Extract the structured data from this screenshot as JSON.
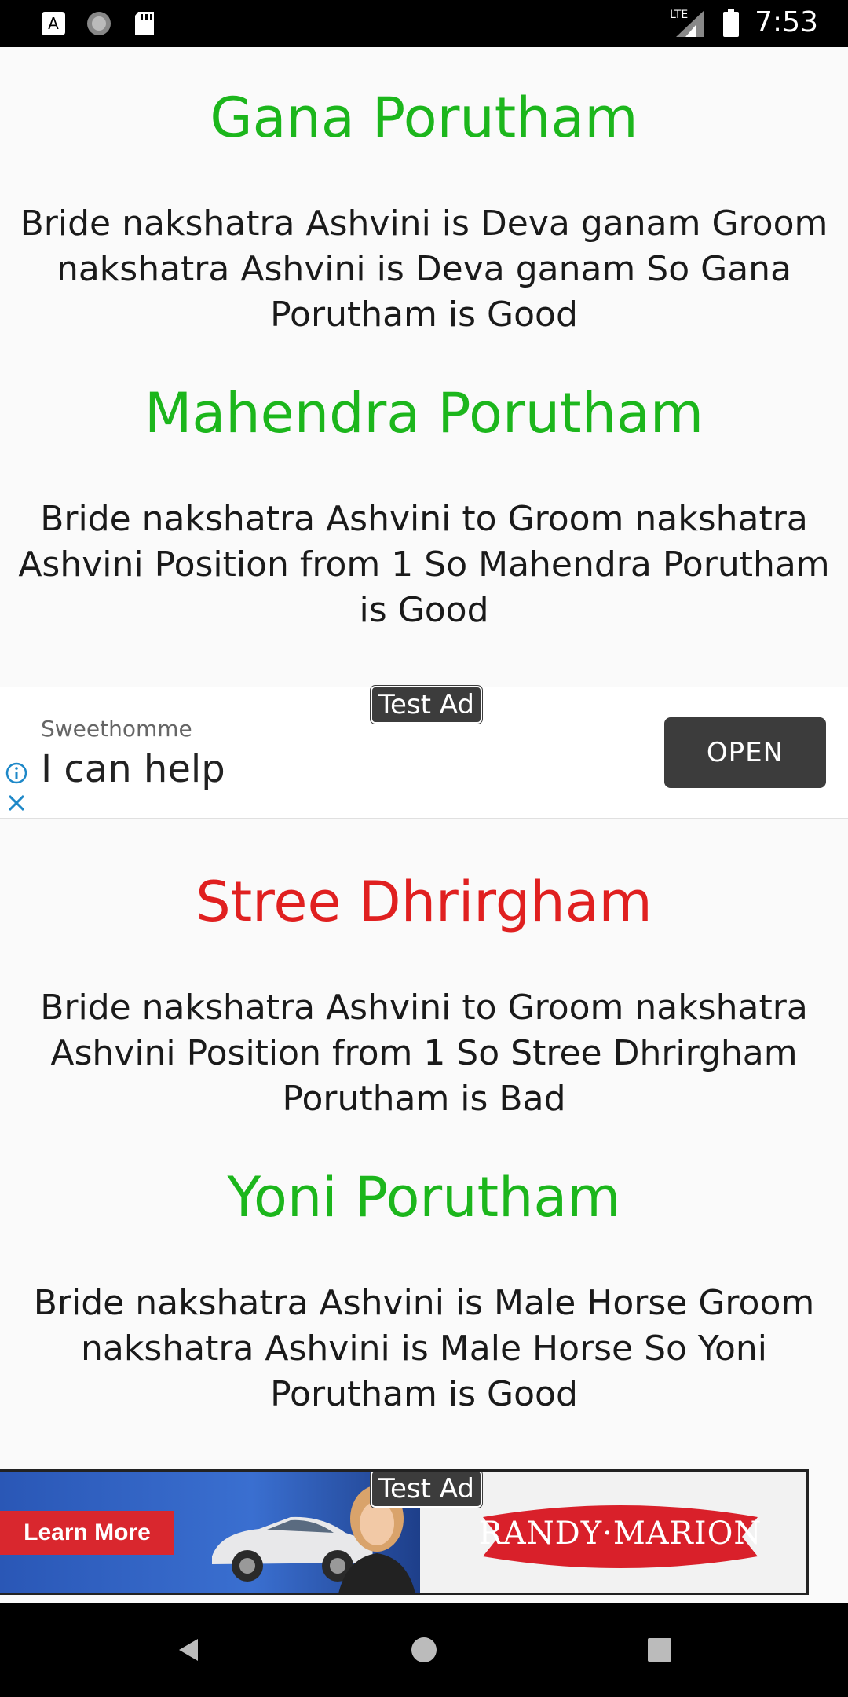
{
  "status_bar": {
    "time": "7:53",
    "network": "LTE",
    "icons": [
      "text-icon",
      "sync-icon",
      "sd-card-icon",
      "signal-icon",
      "battery-icon"
    ]
  },
  "sections": [
    {
      "title": "Gana Porutham",
      "color": "#1cb61c",
      "description": "Bride nakshatra Ashvini is Deva ganam Groom nakshatra Ashvini is Deva ganam So Gana Porutham is  Good"
    },
    {
      "title": "Mahendra Porutham",
      "color": "#1cb61c",
      "description": "Bride nakshatra Ashvini to Groom nakshatra Ashvini Position from 1 So Mahendra Porutham is Good"
    },
    {
      "title": "Stree Dhrirgham",
      "color": "#e02020",
      "description": "Bride nakshatra Ashvini to Groom nakshatra Ashvini Position from 1 So Stree Dhrirgham Porutham is Bad"
    },
    {
      "title": "Yoni Porutham",
      "color": "#1cb61c",
      "description": "Bride nakshatra Ashvini is Male Horse Groom nakshatra Ashvini is Male Horse So Yoni Porutham is  Good"
    }
  ],
  "native_ad": {
    "badge": "Test Ad",
    "advertiser": "Sweethomme",
    "headline": "I can help",
    "cta": "OPEN"
  },
  "banner_ad": {
    "badge": "Test Ad",
    "cta": "Learn More",
    "brand": "RANDY·MARION"
  }
}
